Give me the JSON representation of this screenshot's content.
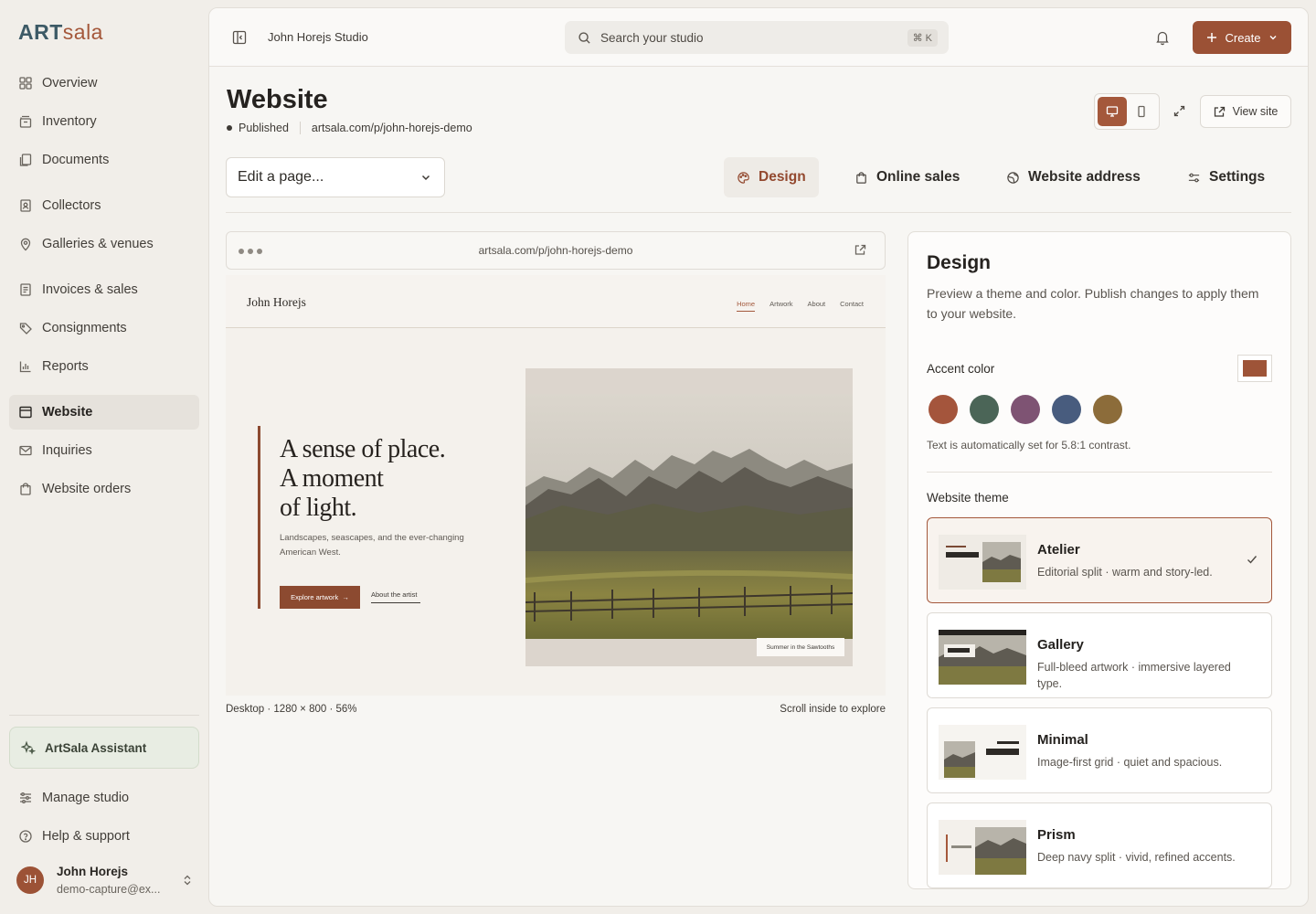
{
  "brand": {
    "part1": "ART",
    "part2": "sala"
  },
  "sidebar": {
    "items": [
      {
        "label": "Overview",
        "icon": "grid-icon"
      },
      {
        "label": "Inventory",
        "icon": "archive-icon"
      },
      {
        "label": "Documents",
        "icon": "documents-icon"
      },
      {
        "label": "Collectors",
        "icon": "contact-icon"
      },
      {
        "label": "Galleries & venues",
        "icon": "map-pin-icon"
      },
      {
        "label": "Invoices & sales",
        "icon": "invoice-icon"
      },
      {
        "label": "Consignments",
        "icon": "tag-icon"
      },
      {
        "label": "Reports",
        "icon": "bar-chart-icon"
      },
      {
        "label": "Website",
        "icon": "browser-icon",
        "active": true
      },
      {
        "label": "Inquiries",
        "icon": "mail-icon"
      },
      {
        "label": "Website orders",
        "icon": "shopping-bag-icon"
      }
    ],
    "assistant_label": "ArtSala Assistant",
    "manage_label": "Manage studio",
    "help_label": "Help & support",
    "user": {
      "initials": "JH",
      "name": "John Horejs",
      "email": "demo-capture@ex..."
    }
  },
  "topbar": {
    "studio_name": "John Horejs Studio",
    "search_placeholder": "Search your studio",
    "shortcut": "⌘ K",
    "create_label": "Create"
  },
  "page": {
    "title": "Website",
    "status": "Published",
    "url": "artsala.com/p/john-horejs-demo",
    "view_site_label": "View site",
    "edit_select_value": "Edit a page..."
  },
  "tabs": [
    {
      "label": "Design",
      "icon": "palette-icon",
      "active": true
    },
    {
      "label": "Online sales",
      "icon": "shopping-bag-icon"
    },
    {
      "label": "Website address",
      "icon": "globe-icon"
    },
    {
      "label": "Settings",
      "icon": "sliders-icon"
    }
  ],
  "preview": {
    "browser_url": "artsala.com/p/john-horejs-demo",
    "site": {
      "artist_name": "John Horejs",
      "nav_links": [
        "Home",
        "Artwork",
        "About",
        "Contact"
      ],
      "hero_title_lines": [
        "A sense of place.",
        "A moment",
        "of light."
      ],
      "hero_subtitle": "Landscapes, seascapes, and the ever-changing American West.",
      "primary_cta": "Explore artwork",
      "secondary_cta": "About the artist",
      "image_caption": "Summer in the Sawtooths"
    },
    "meta": "Desktop · 1280 × 800 · 56%",
    "scroll_hint": "Scroll inside to explore"
  },
  "design_panel": {
    "title": "Design",
    "description": "Preview a theme and color. Publish changes to apply them to your website.",
    "accent_label": "Accent color",
    "accent_selected": "#9e5438",
    "swatches": [
      "#a4553c",
      "#4b6557",
      "#7e5373",
      "#485c7e",
      "#8c6c3a"
    ],
    "contrast_note": "Text is automatically set for 5.8:1 contrast.",
    "theme_label": "Website theme",
    "themes": [
      {
        "name": "Atelier",
        "description": "Editorial split · warm and story-led.",
        "selected": true
      },
      {
        "name": "Gallery",
        "description": "Full-bleed artwork · immersive layered type."
      },
      {
        "name": "Minimal",
        "description": "Image-first grid · quiet and spacious."
      },
      {
        "name": "Prism",
        "description": "Deep navy split · vivid, refined accents."
      }
    ]
  }
}
